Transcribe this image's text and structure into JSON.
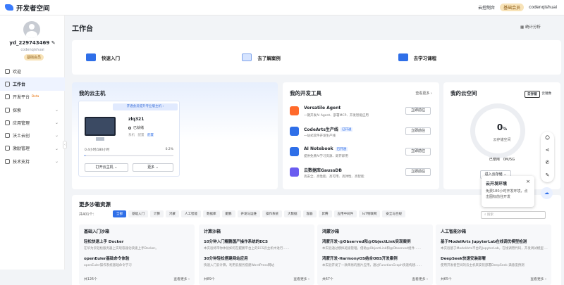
{
  "topbar": {
    "title": "开发者空间",
    "console": "云控制台",
    "vip": "基础会员",
    "user": "codenqishuai"
  },
  "profile": {
    "name": "yd_229743469",
    "sub": "codenqishuai",
    "badge": "基础会员"
  },
  "menu": [
    {
      "label": "欢迎",
      "chev": ""
    },
    {
      "label": "工作台",
      "chev": ""
    },
    {
      "label": "开发平台",
      "chev": "",
      "beta": "Beta"
    },
    {
      "label": "探索",
      "chev": "⌄"
    },
    {
      "label": "应用管理",
      "chev": "⌄"
    },
    {
      "label": "沃土云创",
      "chev": "⌄"
    },
    {
      "label": "激励管理",
      "chev": "⌄"
    },
    {
      "label": "技术支持",
      "chev": "⌄"
    }
  ],
  "page": {
    "title": "工作台",
    "stats": "统计分析"
  },
  "quick": [
    "快速入门",
    "去了解案例",
    "去学习课程"
  ],
  "host": {
    "title": "我的云主机",
    "banner": "开通会员提升专业版主机 ›",
    "name": "zlq321",
    "status": "已就绪",
    "tag1": "系机",
    "tag2": "配置",
    "tag3": "配置",
    "usage": "0.4小时/180小时",
    "pct": "0.2%",
    "progress": 0.002,
    "open_btn": "打开云主机 ⌄",
    "more_btn": "更多 ⌄"
  },
  "tools": {
    "title": "我的开发工具",
    "more": "查看更多 ›",
    "items": [
      {
        "name": "Versatile Agent",
        "tag": "",
        "desc": "一键开发AI Agent、部署MCP、开发智能应用",
        "btn": "立即前往",
        "color": "#ff6a2b"
      },
      {
        "name": "CodeArts生产线",
        "tag": "已开通",
        "desc": "一站式软件开发生产线",
        "btn": "立即前往",
        "color": "#2f6fe8"
      },
      {
        "name": "AI Notebook",
        "tag": "已开通",
        "desc": "提供免费AI学习资源、即开即用",
        "btn": "立即前往",
        "color": "#2f6fe8"
      },
      {
        "name": "云数据库GaussDB",
        "tag": "",
        "desc": "高安全、高性能、高可用、高弹性、高智能",
        "btn": "立即前往",
        "color": "#6a5cf0"
      }
    ]
  },
  "space": {
    "title": "我的云空间",
    "tab1": "云存储",
    "tab2": "云镜像",
    "value": "0",
    "unit": "%",
    "label": "云存储空间",
    "used": "已使用　0M/5G",
    "btn": "进入云存储 ⌄"
  },
  "sandbox": {
    "title": "更多沙箱资源",
    "count": "共401个：",
    "chips": [
      "全部",
      "基础入门",
      "计算",
      "鸿蒙",
      "人工智能",
      "数据库",
      "鲲鹏",
      "开发与运维",
      "操作系统",
      "大数据",
      "容器",
      "昇腾",
      "应用中间件",
      "IoT物联网",
      "安全与合规"
    ],
    "search": "搜索",
    "cols": [
      {
        "head": "基础入门沙箱",
        "i1": "轻松快速上手 Docker",
        "d1": "在华为云轻松服务器上实现容器化快速上手Docker。",
        "i2": "openEuler基础命令体验",
        "d2": "openEuler操作系统基础命令学习",
        "foot": "共126个",
        "more": "查看更多 ›"
      },
      {
        "head": "计算沙箱",
        "i1": "10分钟入门鲲鹏国产操作系统的ECS",
        "d1": "本实验将带你体验如何在鲲鹏平台上的ECS云主机中进行……",
        "i2": "30分钟轻松搭建网站应用",
        "d2": "快速入门云计算，利用云服务搭建WordPress网站",
        "foot": "共89个",
        "more": "查看更多 ›"
      },
      {
        "head": "鸿蒙沙箱",
        "i1": "鸿蒙开发-@Observed和@ObjectLink实现案例",
        "d1": "本实验通过模拟班级管理，借助@ObjectLink和@Observed组件……",
        "i2": "鸿蒙开发-HarmonyOS结合OBS开发案例",
        "d2": "本实验开发了一款简易的图片应用，通过FunctionGraph快速构建……",
        "foot": "共67个",
        "more": "查看更多 ›"
      },
      {
        "head": "人工智能沙箱",
        "i1": "基于ModelArts JupyterLab在线调优模型检测",
        "d1": "本实验基于ModelArts平台的JupyterLab，在线调用代码，开发调试模型……",
        "i2": "DeepSeek快速安装部署",
        "d2": "使用开发者空间的云主机来安装部署DeepSeek 满意度预测",
        "foot": "共65个",
        "more": "查看更多 ›"
      }
    ]
  },
  "popup": {
    "title": "云开发环境",
    "text": "免费180小时开发环境，点击图标前往开发",
    "close": "×"
  }
}
